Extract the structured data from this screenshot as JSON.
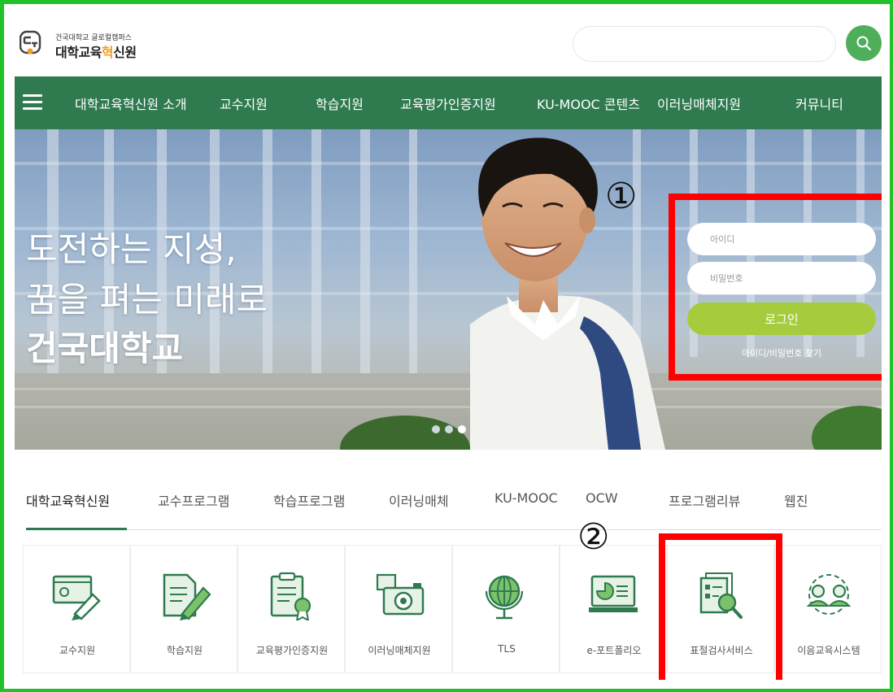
{
  "header": {
    "logo_small": "건국대학교 글로컬캠퍼스",
    "logo_big_pre": "대학교육",
    "logo_big_accent": "혁",
    "logo_big_post": "신원",
    "search_value": "",
    "search_icon": "search-icon"
  },
  "nav": {
    "menu_icon": "hamburger-icon",
    "items": [
      "대학교육혁신원 소개",
      "교수지원",
      "학습지원",
      "교육평가인증지원",
      "KU-MOOC 콘텐츠",
      "이러닝매체지원",
      "커뮤니티"
    ]
  },
  "hero": {
    "line1": "도전하는 지성,",
    "line2": "꿈을 펴는 미래로",
    "line3": "건국대학교",
    "slide_count": 3,
    "active_slide": 3
  },
  "login": {
    "id_placeholder": "아이디",
    "pw_placeholder": "비밀번호",
    "button": "로그인",
    "find_link": "아이디/비밀번호 찾기"
  },
  "annotations": {
    "marker1": "①",
    "marker2": "②",
    "color": "#ff0000"
  },
  "tabs": {
    "items": [
      "대학교육혁신원",
      "교수프로그램",
      "학습프로그램",
      "이러닝매체",
      "KU-MOOC",
      "OCW",
      "프로그램리뷰",
      "웹진"
    ],
    "active_index": 0
  },
  "services": {
    "items": [
      {
        "label": "교수지원",
        "icon": "pen-screen-icon"
      },
      {
        "label": "학습지원",
        "icon": "document-pencil-icon"
      },
      {
        "label": "교육평가인증지원",
        "icon": "certificate-clipboard-icon"
      },
      {
        "label": "이러닝매체지원",
        "icon": "camera-icon"
      },
      {
        "label": "TLS",
        "icon": "globe-icon"
      },
      {
        "label": "e-포트폴리오",
        "icon": "monitor-chart-icon"
      },
      {
        "label": "표절검사서비스",
        "icon": "document-magnifier-icon"
      },
      {
        "label": "이음교육시스템",
        "icon": "people-exchange-icon"
      }
    ]
  },
  "colors": {
    "nav_green": "#2f7a4e",
    "search_green": "#4fae5a",
    "login_button": "#a6cc3e",
    "frame_green": "#22c22a",
    "logo_accent": "#f0a020"
  }
}
